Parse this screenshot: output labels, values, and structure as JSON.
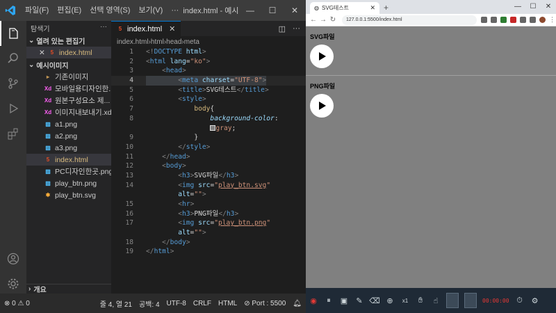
{
  "vscode": {
    "menu": [
      "파일(F)",
      "편집(E)",
      "선택 영역(S)",
      "보기(V)",
      "···"
    ],
    "window_title": "index.html - 예시이미...",
    "explorer": {
      "title": "탐색기",
      "open_editors_label": "열려 있는 편집기",
      "open_file": "index.html",
      "folder_label": "예시이미지",
      "items": [
        {
          "name": "기존이미지",
          "kind": "folder"
        },
        {
          "name": "모바일용디자인한...",
          "kind": "xd"
        },
        {
          "name": "원본구성요소 제...",
          "kind": "xd"
        },
        {
          "name": "이미지내보내기.xd",
          "kind": "xd"
        },
        {
          "name": "a1.png",
          "kind": "png"
        },
        {
          "name": "a2.png",
          "kind": "png"
        },
        {
          "name": "a3.png",
          "kind": "png"
        },
        {
          "name": "index.html",
          "kind": "html"
        },
        {
          "name": "PC디자인한곳.png",
          "kind": "png"
        },
        {
          "name": "play_btn.png",
          "kind": "png"
        },
        {
          "name": "play_btn.svg",
          "kind": "svg"
        }
      ],
      "outline_label": "개요"
    },
    "tab": {
      "label": "index.html"
    },
    "breadcrumb": [
      "index.html",
      "html",
      "head",
      "meta"
    ],
    "code_lines": [
      {
        "n": "1",
        "html": "<span class='tg'>&lt;!</span><span class='tn'>DOCTYPE</span> <span class='at'>html</span><span class='tg'>&gt;</span>"
      },
      {
        "n": "2",
        "html": "<span class='tg'>&lt;</span><span class='tn'>html</span> <span class='at'>lang</span><span class='tx'>=</span><span class='sv'>\"ko\"</span><span class='tg'>&gt;</span>"
      },
      {
        "n": "3",
        "html": "    <span class='tg'>&lt;</span><span class='tn'>head</span><span class='tg'>&gt;</span>"
      },
      {
        "n": "4",
        "html": "        <span class='tg'>&lt;</span><span class='tn'>meta</span> <span class='at'>charset</span><span class='tx'>=</span><span class='sv'>\"UTF-8\"</span><span class='tg'>&gt;</span>",
        "current": true
      },
      {
        "n": "5",
        "html": "        <span class='tg'>&lt;</span><span class='tn'>title</span><span class='tg'>&gt;</span><span class='tx'>SVG테스트</span><span class='tg'>&lt;/</span><span class='tn'>title</span><span class='tg'>&gt;</span>"
      },
      {
        "n": "6",
        "html": "        <span class='tg'>&lt;</span><span class='tn'>style</span><span class='tg'>&gt;</span>"
      },
      {
        "n": "7",
        "html": "            <span class='sel'>body</span><span class='tx'>{</span>"
      },
      {
        "n": "8",
        "html": "                <span class='pr'>background-color</span><span class='tx'>:</span>"
      },
      {
        "n": "",
        "html": "                <span style='display:inline-block;width:8px;height:8px;background:#808080;border:1px solid #ddd;vertical-align:middle'></span><span class='sv'>gray</span><span class='tx'>;</span>"
      },
      {
        "n": "9",
        "html": "            <span class='tx'>}</span>"
      },
      {
        "n": "10",
        "html": "        <span class='tg'>&lt;/</span><span class='tn'>style</span><span class='tg'>&gt;</span>"
      },
      {
        "n": "11",
        "html": "    <span class='tg'>&lt;/</span><span class='tn'>head</span><span class='tg'>&gt;</span>"
      },
      {
        "n": "12",
        "html": "    <span class='tg'>&lt;</span><span class='tn'>body</span><span class='tg'>&gt;</span>"
      },
      {
        "n": "13",
        "html": "        <span class='tg'>&lt;</span><span class='tn'>h3</span><span class='tg'>&gt;</span><span class='tx'>SVG파일</span><span class='tg'>&lt;/</span><span class='tn'>h3</span><span class='tg'>&gt;</span>"
      },
      {
        "n": "14",
        "html": "        <span class='tg'>&lt;</span><span class='tn'>img</span> <span class='at'>src</span><span class='tx'>=</span><span class='sv'>\"<span class='lk'>play_btn.svg</span>\"</span>"
      },
      {
        "n": "",
        "html": "        <span class='at'>alt</span><span class='tx'>=</span><span class='sv'>\"\"</span><span class='tg'>&gt;</span>"
      },
      {
        "n": "15",
        "html": "        <span class='tg'>&lt;</span><span class='tn'>hr</span><span class='tg'>&gt;</span>"
      },
      {
        "n": "16",
        "html": "        <span class='tg'>&lt;</span><span class='tn'>h3</span><span class='tg'>&gt;</span><span class='tx'>PNG파일</span><span class='tg'>&lt;/</span><span class='tn'>h3</span><span class='tg'>&gt;</span>"
      },
      {
        "n": "17",
        "html": "        <span class='tg'>&lt;</span><span class='tn'>img</span> <span class='at'>src</span><span class='tx'>=</span><span class='sv'>\"<span class='lk'>play_btn.png</span>\"</span>"
      },
      {
        "n": "",
        "html": "        <span class='at'>alt</span><span class='tx'>=</span><span class='sv'>\"\"</span><span class='tg'>&gt;</span>"
      },
      {
        "n": "18",
        "html": "    <span class='tg'>&lt;/</span><span class='tn'>body</span><span class='tg'>&gt;</span>"
      },
      {
        "n": "19",
        "html": "<span class='tg'>&lt;/</span><span class='tn'>html</span><span class='tg'>&gt;</span>"
      }
    ],
    "status": {
      "problems": "⊗ 0 ⚠ 0",
      "position": "줄 4, 열 21",
      "spaces": "공백: 4",
      "encoding": "UTF-8",
      "eol": "CRLF",
      "language": "HTML",
      "port": "⊘ Port : 5500"
    }
  },
  "browser": {
    "tab_title": "SVG테스트",
    "url": "127.0.0.1:5500/index.html",
    "page": {
      "svg_heading": "SVG파일",
      "png_heading": "PNG파일"
    },
    "background_color": "#808080"
  },
  "taskbar": {
    "zoom_label": "x1",
    "recording_time": "00:00:00"
  }
}
